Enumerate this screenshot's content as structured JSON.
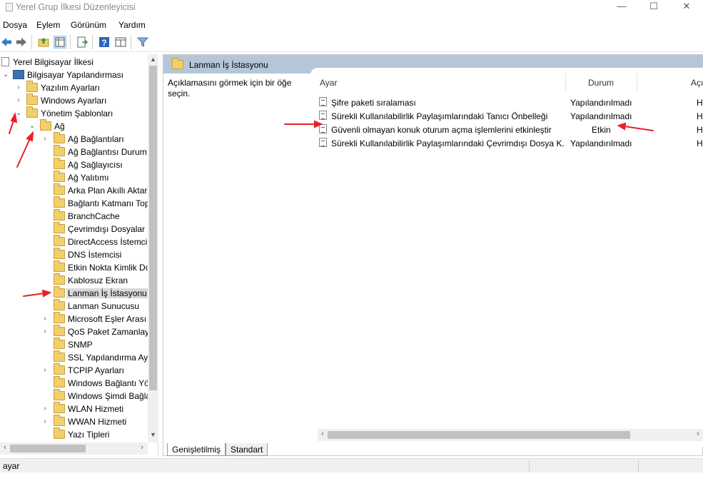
{
  "window": {
    "title": "Yerel Grup İlkesi Düzenleyicisi",
    "controls": {
      "minimize": "—",
      "maximize": "☐",
      "close": "✕"
    }
  },
  "menu": [
    "Dosya",
    "Eylem",
    "Görünüm",
    "Yardım"
  ],
  "toolbar": {
    "icons": [
      "back-icon",
      "forward-icon",
      "up-folder-icon",
      "show-hide-tree-icon",
      "export-list-icon",
      "help-icon",
      "extended-view-icon",
      "filter-icon"
    ]
  },
  "tree": {
    "root": "Yerel Bilgisayar İlkesi",
    "computer_config": "Bilgisayar Yapılandırması",
    "software_settings": "Yazılım Ayarları",
    "windows_settings": "Windows Ayarları",
    "admin_templates": "Yönetim Şablonları",
    "network": "Ağ",
    "children": [
      {
        "label": "Ağ Bağlantıları",
        "expandable": true
      },
      {
        "label": "Ağ Bağlantısı Durum",
        "expandable": false
      },
      {
        "label": "Ağ Sağlayıcısı",
        "expandable": false
      },
      {
        "label": "Ağ Yalıtımı",
        "expandable": false
      },
      {
        "label": "Arka Plan Akıllı Aktar",
        "expandable": false
      },
      {
        "label": "Bağlantı Katmanı Top",
        "expandable": false
      },
      {
        "label": "BranchCache",
        "expandable": false
      },
      {
        "label": "Çevrimdışı Dosyalar",
        "expandable": false
      },
      {
        "label": "DirectAccess İstemci",
        "expandable": false
      },
      {
        "label": "DNS İstemcisi",
        "expandable": false
      },
      {
        "label": "Etkin Nokta Kimlik Do",
        "expandable": false
      },
      {
        "label": "Kablosuz Ekran",
        "expandable": false
      },
      {
        "label": "Lanman İş İstasyonu",
        "expandable": false,
        "selected": true
      },
      {
        "label": "Lanman Sunucusu",
        "expandable": false
      },
      {
        "label": "Microsoft Eşler Arası",
        "expandable": true
      },
      {
        "label": "QoS Paket Zamanlayı",
        "expandable": true
      },
      {
        "label": "SNMP",
        "expandable": false
      },
      {
        "label": "SSL Yapılandırma Aya",
        "expandable": false
      },
      {
        "label": "TCPIP Ayarları",
        "expandable": true
      },
      {
        "label": "Windows Bağlantı Yö",
        "expandable": false
      },
      {
        "label": "Windows Şimdi Bağla",
        "expandable": false
      },
      {
        "label": "WLAN Hizmeti",
        "expandable": true
      },
      {
        "label": "WWAN Hizmeti",
        "expandable": true
      },
      {
        "label": "Yazı Tipleri",
        "expandable": false
      }
    ]
  },
  "right": {
    "header": "Lanman İş İstasyonu",
    "description": "Açıklamasını görmek için bir öğe seçin.",
    "columns": {
      "setting": "Ayar",
      "state": "Durum",
      "comment": "Açı"
    },
    "rows": [
      {
        "name": "Şifre paketi sıralaması",
        "state": "Yapılandırılmadı",
        "comment": "H"
      },
      {
        "name": "Sürekli Kullanılabilirlik Paylaşımlarındaki Tanıcı Önbelleği",
        "state": "Yapılandırılmadı",
        "comment": "H"
      },
      {
        "name": "Güvenli olmayan konuk oturum açma işlemlerini etkinleştir",
        "state": "Etkin",
        "comment": "H"
      },
      {
        "name": "Sürekli Kullanılabilirlik Paylaşımlarındaki Çevrimdışı Dosya K...",
        "state": "Yapılandırılmadı",
        "comment": "H"
      }
    ]
  },
  "tabs": [
    "Genişletilmiş",
    "Standart"
  ],
  "status": {
    "text": "ayar"
  },
  "colors": {
    "header_bg": "#b5c6d8",
    "annotation": "#e8202a",
    "folder": "#f1cf6b"
  }
}
